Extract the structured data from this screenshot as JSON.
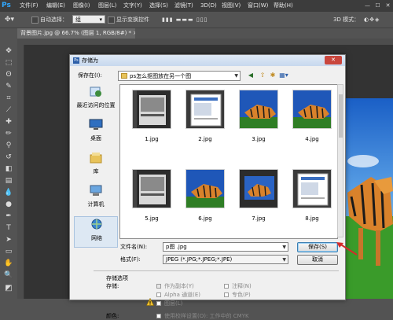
{
  "app": {
    "logo": "Ps"
  },
  "menubar": {
    "items": [
      "文件(F)",
      "编辑(E)",
      "图像(I)",
      "图层(L)",
      "文字(Y)",
      "选择(S)",
      "滤镜(T)",
      "3D(D)",
      "视图(V)",
      "窗口(W)",
      "帮助(H)"
    ],
    "window_buttons": [
      "—",
      "☐",
      "✕"
    ]
  },
  "options": {
    "auto_select_label": "自动选择：",
    "auto_select_value": "组",
    "transform_label": "显示变换控件",
    "mode_label": "3D 模式："
  },
  "doc_tab": {
    "label": "背景图片.jpg @ 66.7% (图层 1, RGB/8#) *",
    "close": "×"
  },
  "dialog": {
    "title": "存储为",
    "close": "✕",
    "save_in_label": "保存在(I):",
    "folder": "ps怎么抠图放在另一个图",
    "places": [
      {
        "label": "最近访问的位置",
        "icon": "recent-places-icon"
      },
      {
        "label": "桌面",
        "icon": "desktop-icon"
      },
      {
        "label": "库",
        "icon": "library-icon"
      },
      {
        "label": "计算机",
        "icon": "computer-icon"
      },
      {
        "label": "网络",
        "icon": "network-icon"
      }
    ],
    "files": [
      {
        "name": "1.jpg",
        "kind": "screenshot"
      },
      {
        "name": "2.jpg",
        "kind": "screenshot-white"
      },
      {
        "name": "3.jpg",
        "kind": "tiger-blue"
      },
      {
        "name": "4.jpg",
        "kind": "tiger-blue"
      },
      {
        "name": "5.jpg",
        "kind": "screenshot"
      },
      {
        "name": "6.jpg",
        "kind": "tiger-blue"
      },
      {
        "name": "7.jpg",
        "kind": "screenshot-tiger"
      },
      {
        "name": "8.jpg",
        "kind": "screenshot-white"
      }
    ],
    "filename_label": "文件名(N):",
    "filename_value": "p图 .jpg",
    "format_label": "格式(F):",
    "format_value": "JPEG (*.JPG;*.JPEG;*.JPE)",
    "save_button": "保存(S)",
    "cancel_button": "取消",
    "save_options_title": "存储选项",
    "save_label": "存储:",
    "as_copy": "作为副本(Y)",
    "notes": "注释(N)",
    "alpha_channels": "Alpha 通道(E)",
    "spot_colors": "专色(P)",
    "layers": "图层(L)",
    "color_label": "颜色:",
    "proof_setup": "使用校样设置(O):  工作中的 CMYK"
  },
  "colors": {
    "accent_red": "#d42a2a",
    "sky": "#1e6fd0",
    "grass": "#3a9b2a"
  }
}
